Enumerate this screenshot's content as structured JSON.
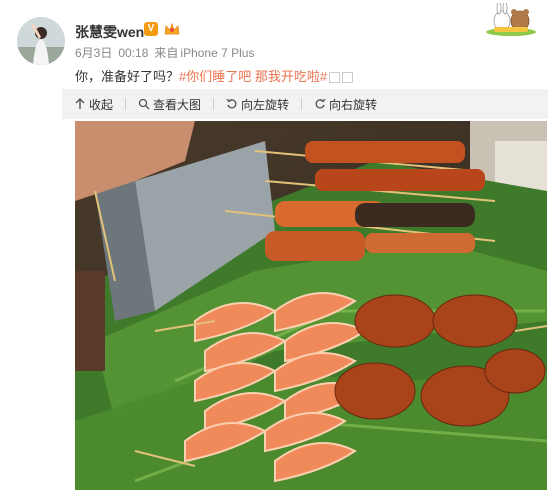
{
  "user": {
    "name": "张慧雯wen",
    "verified_label": "V"
  },
  "meta": {
    "date": "6月3日",
    "time": "00:18",
    "source_prefix": "来自",
    "device": "iPhone 7 Plus"
  },
  "post": {
    "text_plain": "你，准备好了吗？",
    "hashtag": "#你们睡了吧 那我开吃啦#"
  },
  "toolbar": {
    "collapse": "收起",
    "view_large": "查看大图",
    "rotate_left": "向左旋转",
    "rotate_right": "向右旋转"
  },
  "icons": {
    "collapse": "arrow-up-icon",
    "view_large": "magnifier-icon",
    "rotate_left": "rotate-left-icon",
    "rotate_right": "rotate-right-icon",
    "avatar": "avatar",
    "badge": "crown-icon"
  },
  "colors": {
    "accent": "#eb7350",
    "verified": "#f39c12",
    "toolbar_bg": "#f2f2f5"
  }
}
